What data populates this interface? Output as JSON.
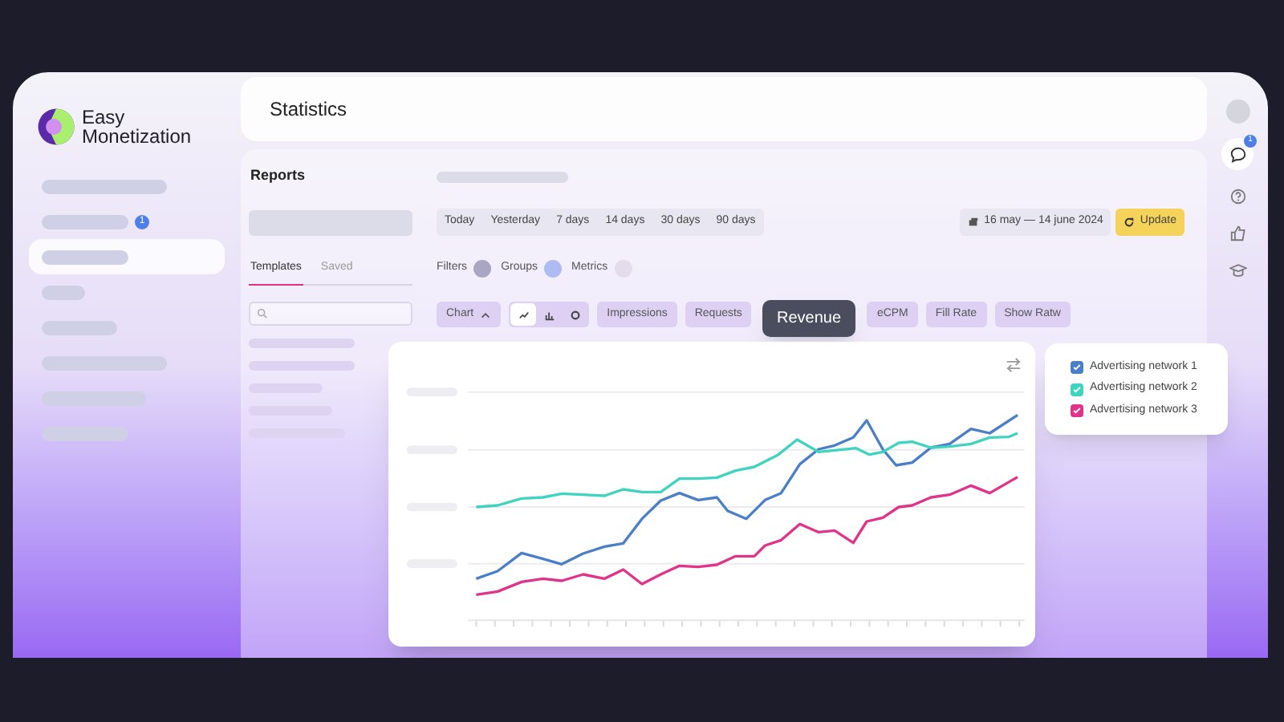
{
  "logo": {
    "lines": [
      "Easy",
      "Monetization"
    ]
  },
  "sidebar": {
    "items": [
      {
        "selected": false
      },
      {
        "selected": false,
        "badge": "1"
      },
      {
        "selected": true
      },
      {
        "selected": false
      },
      {
        "selected": false
      },
      {
        "selected": false
      },
      {
        "selected": false
      },
      {
        "selected": false
      }
    ]
  },
  "header": {
    "title": "Statistics"
  },
  "reports": {
    "title": "Reports",
    "tabs": [
      {
        "label": "Templates",
        "selected": true
      },
      {
        "label": "Saved",
        "selected": false
      }
    ]
  },
  "periods": [
    {
      "label": "Today"
    },
    {
      "label": "Yesterday"
    },
    {
      "label": "7 days"
    },
    {
      "label": "14 days"
    },
    {
      "label": "30 days"
    },
    {
      "label": "90 days"
    }
  ],
  "date_range": "16 may — 14 june 2024",
  "update_button": "Update",
  "toggles": [
    {
      "label": "Filters",
      "color": "#a9a6c4"
    },
    {
      "label": "Groups",
      "color": "#aebcf2"
    },
    {
      "label": "Metrics",
      "color": "#e4dcea"
    }
  ],
  "chart_toolbar": {
    "chart_menu": {
      "label": "Chart",
      "expanded": true
    },
    "chart_types": [
      {
        "kind": "line",
        "selected": true
      },
      {
        "kind": "bar",
        "selected": false
      },
      {
        "kind": "donut",
        "selected": false
      }
    ],
    "metrics_before": [
      "Impressions",
      "Requests"
    ],
    "metrics_after": [
      "eCPM",
      "Fill Rate",
      "Show Ratw"
    ]
  },
  "tooltip": "Revenue",
  "legend": [
    {
      "label": "Advertising network 1",
      "checked": true,
      "color": "#4a7fc8"
    },
    {
      "label": "Advertising network 2",
      "checked": true,
      "color": "#3fd3c0"
    },
    {
      "label": "Advertising network 3",
      "checked": true,
      "color": "#e0338a"
    }
  ],
  "right_rail": {
    "chat_badge": "1"
  }
}
